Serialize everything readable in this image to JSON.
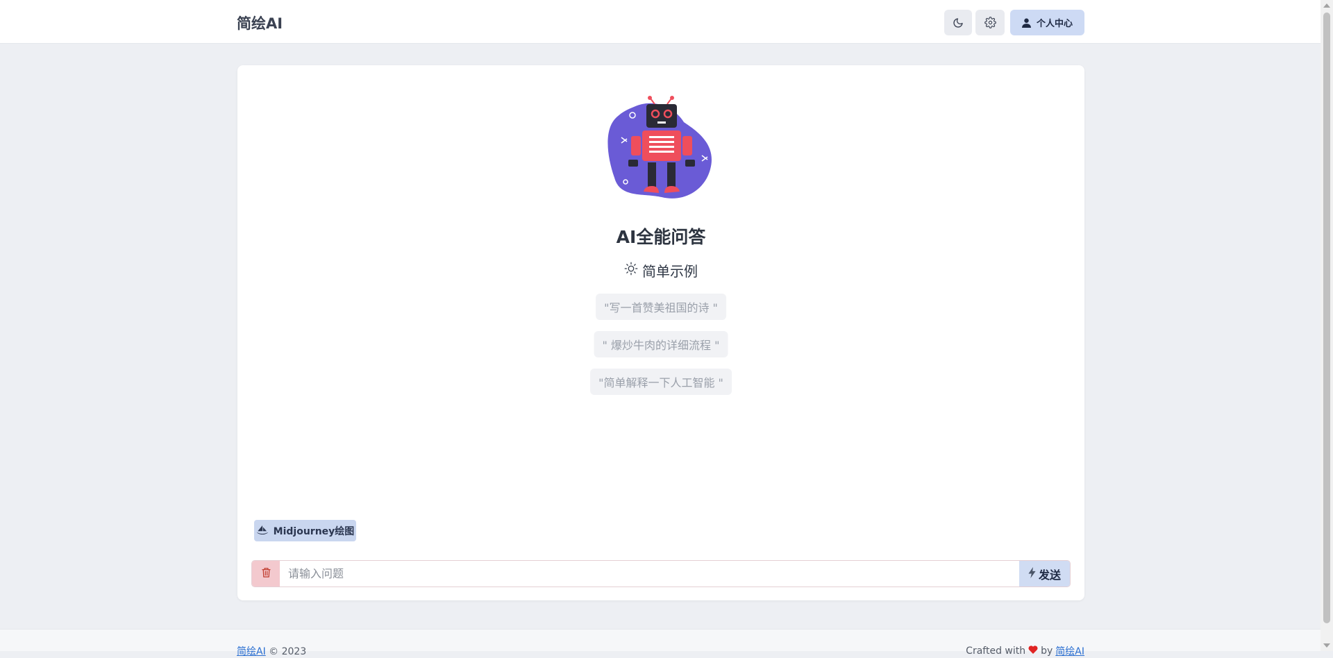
{
  "header": {
    "brand": "简绘AI",
    "theme_toggle_icon": "moon-icon",
    "settings_icon": "gear-icon",
    "user_center_label": "个人中心",
    "user_icon": "user-icon"
  },
  "main": {
    "title": "AI全能问答",
    "examples_heading": "简单示例",
    "examples_icon": "sun-icon",
    "examples": [
      "\"写一首赞美祖国的诗 \"",
      "\" 爆炒牛肉的详细流程 \"",
      "\"简单解释一下人工智能 \""
    ],
    "midjourney_label": "Midjourney绘图",
    "question_placeholder": "请输入问题",
    "send_label": "发送"
  },
  "footer": {
    "brand_link": "简绘AI",
    "copyright": "© 2023",
    "crafted_with": "Crafted with",
    "by": "by",
    "author_link": "简绘AI"
  },
  "colors": {
    "accent": "#cddaf4",
    "danger": "#f3c9ce",
    "robot_blob": "#6a5bd6",
    "robot_body": "#ef4e5c"
  }
}
